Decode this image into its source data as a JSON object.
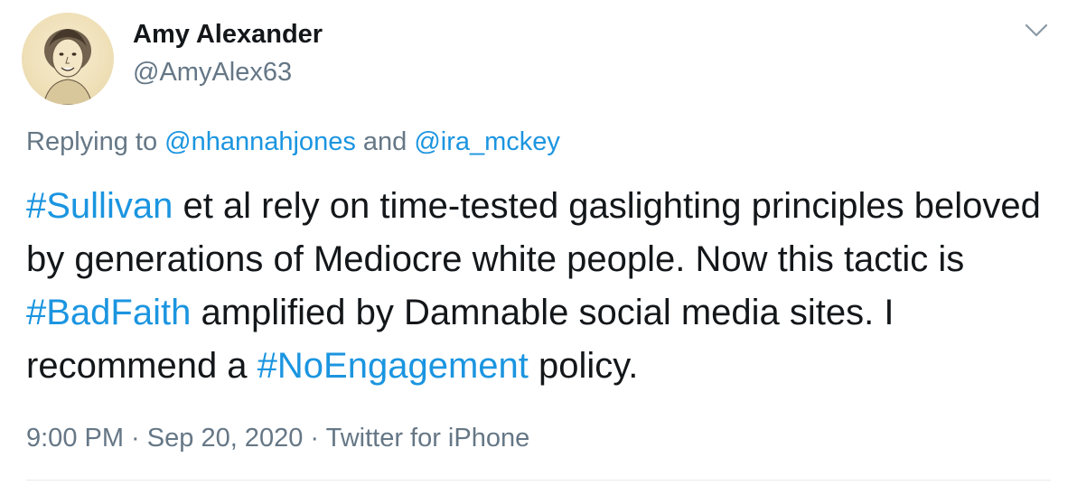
{
  "tweet": {
    "author": {
      "display_name": "Amy Alexander",
      "handle": "@AmyAlex63",
      "avatar_icon": "profile-photo"
    },
    "menu_icon": "chevron-down-icon",
    "reply": {
      "prefix": "Replying to ",
      "mentions": [
        "@nhannahjones",
        "@ira_mckey"
      ],
      "joiner": " and "
    },
    "text": {
      "hashtag_1": "#Sullivan",
      "part_1": " et al rely on time-tested gaslighting principles beloved by generations of Mediocre white people. Now this tactic is ",
      "hashtag_2": "#BadFaith",
      "part_2": " amplified by Damnable social media sites. I recommend a ",
      "hashtag_3": "#NoEngagement",
      "part_3": " policy."
    },
    "meta": {
      "time": "9:00 PM",
      "separator": " · ",
      "date": "Sep 20, 2020",
      "source": "Twitter for iPhone"
    }
  },
  "colors": {
    "link": "#1b95e0",
    "secondary_text": "#657786",
    "primary_text": "#14171a",
    "divider": "#e6ecf0"
  }
}
